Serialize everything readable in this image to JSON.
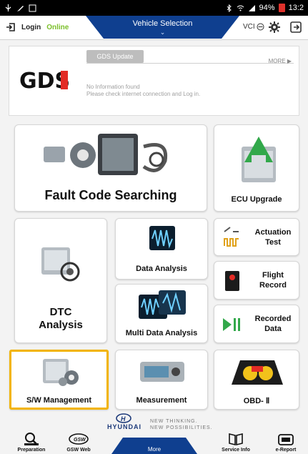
{
  "statusbar": {
    "battery": "94%",
    "time": "13:2"
  },
  "topbar": {
    "login": "Login",
    "status": "Online",
    "vehicle_tab": "Vehicle Selection",
    "vci": "VCI"
  },
  "news": {
    "tab": "GDS Update",
    "more": "MORE ▶",
    "line1": "No Information found",
    "line2": "Please check internet connection and Log in.",
    "logo_text": "GDS"
  },
  "tiles": {
    "fault_code": "Fault Code Searching",
    "ecu_upgrade": "ECU Upgrade",
    "dtc_analysis_1": "DTC",
    "dtc_analysis_2": "Analysis",
    "data_analysis": "Data Analysis",
    "actuation_1": "Actuation",
    "actuation_2": "Test",
    "flight_1": "Flight",
    "flight_2": "Record",
    "multi_data": "Multi Data Analysis",
    "recorded_1": "Recorded",
    "recorded_2": "Data",
    "sw_mgmt": "S/W Management",
    "measurement": "Measurement",
    "obd": "OBD- Ⅱ"
  },
  "footer": {
    "brand": "HYUNDAI",
    "tag1": "NEW THINKING.",
    "tag2": "NEW POSSIBILITIES.",
    "nav": [
      "Preparation",
      "GSW Web",
      "More",
      "Service Info",
      "e-Report"
    ]
  },
  "colors": {
    "accent_blue": "#0f3f8f",
    "selection": "#f2b400",
    "online": "#7bbf2a",
    "logo_red": "#e32b25"
  }
}
